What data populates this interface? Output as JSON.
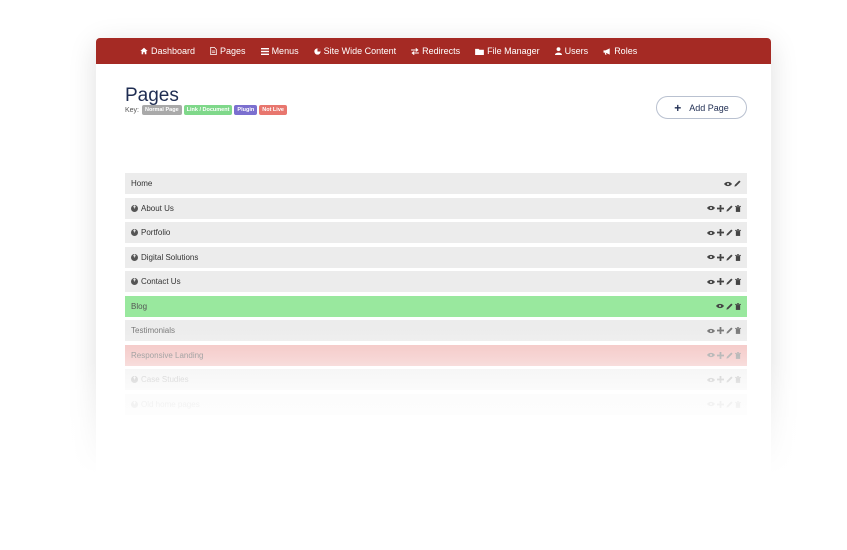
{
  "nav": {
    "items": [
      {
        "label": "Dashboard",
        "icon": "home-icon"
      },
      {
        "label": "Pages",
        "icon": "file-icon"
      },
      {
        "label": "Menus",
        "icon": "menu-icon"
      },
      {
        "label": "Site Wide Content",
        "icon": "pie-icon"
      },
      {
        "label": "Redirects",
        "icon": "exchange-icon"
      },
      {
        "label": "File Manager",
        "icon": "folder-icon"
      },
      {
        "label": "Users",
        "icon": "user-icon"
      },
      {
        "label": "Roles",
        "icon": "bullhorn-icon"
      }
    ]
  },
  "page": {
    "title": "Pages",
    "key_label": "Key:",
    "key_badges": [
      {
        "label": "Normal Page",
        "color": "#a9a9a9"
      },
      {
        "label": "Link / Document",
        "color": "#7fd88a"
      },
      {
        "label": "Plugin",
        "color": "#7b6fcf"
      },
      {
        "label": "Not Live",
        "color": "#e8766e"
      }
    ],
    "add_button": "Add Page"
  },
  "rows": [
    {
      "label": "Home"
    },
    {
      "label": "About Us"
    },
    {
      "label": "Portfolio"
    },
    {
      "label": "Digital Solutions"
    },
    {
      "label": "Contact Us"
    },
    {
      "label": "Blog"
    },
    {
      "label": "Testimonials"
    },
    {
      "label": "Responsive Landing"
    },
    {
      "label": "Case Studies"
    },
    {
      "label": "Old home pages"
    }
  ],
  "colors": {
    "navbar": "#a52a24",
    "title": "#1f2d52",
    "row_normal": "#ececec",
    "row_plugin": "#99e89e",
    "row_notlive": "#f2bfbd"
  }
}
